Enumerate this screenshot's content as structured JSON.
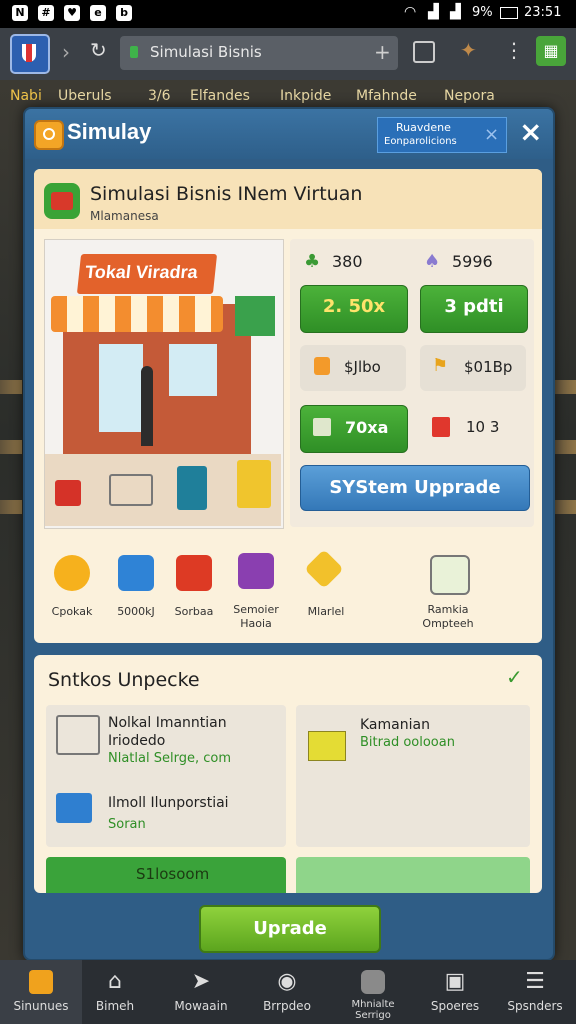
{
  "status_bar": {
    "battery": "9%",
    "time": "23:51"
  },
  "browser": {
    "url_text": "Simulasi Bisnis"
  },
  "category_nav": [
    "Nabi",
    "Uberuls",
    "3/6",
    "Elfandes",
    "Inkpide",
    "Mfahnde",
    "Nepora"
  ],
  "modal": {
    "title": "Simulay",
    "badge_line1": "Ruavdene",
    "badge_line2": "Eonparolicions"
  },
  "game": {
    "title": "Simulasi Bisnis INem Virtuan",
    "subtitle": "Mlamanesa",
    "store_sign": "Tokal Viradra",
    "stats": [
      {
        "icon": "cash-icon",
        "value": "380"
      },
      {
        "icon": "cart-icon",
        "value": "5996"
      },
      {
        "icon": "bag-icon",
        "value": "$Jlbo"
      },
      {
        "icon": "truck-icon",
        "value": "$01Bp"
      },
      {
        "icon": "box-icon",
        "value": "10 3"
      }
    ],
    "green_tiles": [
      "2. 50x",
      "3 pdti",
      "70xa"
    ],
    "upgrade_button": "SYStem Upprade",
    "categories": [
      {
        "icon": "heart-icon",
        "label": "Cpokak"
      },
      {
        "icon": "box-icon",
        "label": "5000kJ"
      },
      {
        "icon": "basket-icon",
        "label": "Sorbaa"
      },
      {
        "icon": "bag-icon",
        "label": "Semoier\nHaoia"
      },
      {
        "icon": "gem-icon",
        "label": "Mlarlel"
      },
      {
        "icon": "cart-icon",
        "label": "Ramkia\nOmpteeh"
      }
    ]
  },
  "upgrades": {
    "title": "Sntkos Unpecke",
    "items": [
      {
        "title": "Nolkal Imanntian",
        "line2": "Iriodedo",
        "status": "Nlatlal Selrge, com"
      },
      {
        "title": "Kamanian",
        "status": "Bitrad oolooan"
      },
      {
        "title": "Ilmoll Ilunporstiai",
        "status": "Soran"
      }
    ],
    "bottom_value": "S1losoom",
    "upgrade_button": "Uprade"
  },
  "bottom_nav": [
    {
      "icon": "simulator-icon",
      "label": "Sinunues"
    },
    {
      "icon": "home-icon",
      "label": "Bimeh"
    },
    {
      "icon": "arrow-icon",
      "label": "Mowaain"
    },
    {
      "icon": "target-icon",
      "label": "Brrpdeo"
    },
    {
      "icon": "manager-icon",
      "label": "Mhnialte\nSerrigo"
    },
    {
      "icon": "games-icon",
      "label": "Spoeres"
    },
    {
      "icon": "menu-icon",
      "label": "Spsnders"
    }
  ]
}
